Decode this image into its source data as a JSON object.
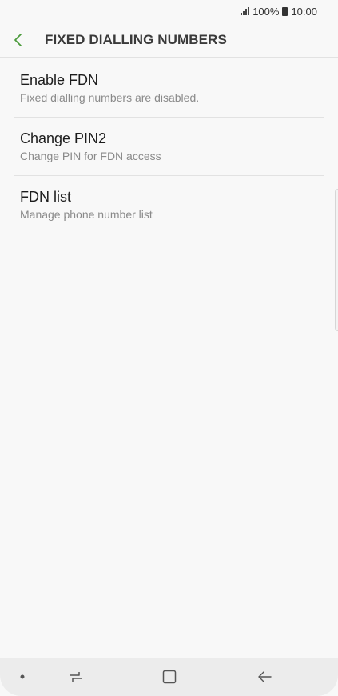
{
  "status_bar": {
    "battery": "100%",
    "time": "10:00"
  },
  "header": {
    "title": "FIXED DIALLING NUMBERS",
    "back_icon": "chevron-left-icon",
    "accent_color": "#4a9a3a"
  },
  "list": {
    "items": [
      {
        "title": "Enable FDN",
        "subtitle": "Fixed dialling numbers are disabled."
      },
      {
        "title": "Change PIN2",
        "subtitle": "Change PIN for FDN access"
      },
      {
        "title": "FDN list",
        "subtitle": "Manage phone number list"
      }
    ]
  },
  "nav_bar": {
    "icons": [
      "dot-icon",
      "recent-apps-icon",
      "home-icon",
      "back-arrow-icon"
    ]
  }
}
